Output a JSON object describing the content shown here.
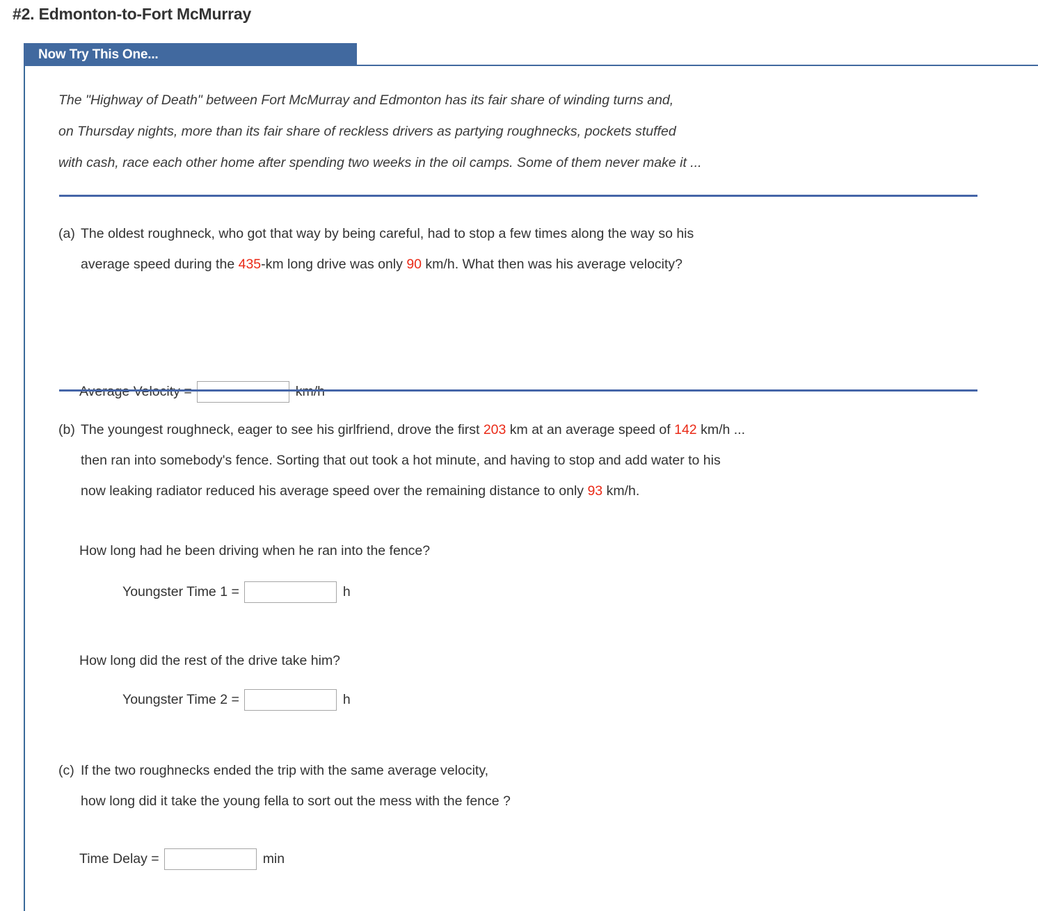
{
  "page": {
    "title": "#2. Edmonton-to-Fort McMurray",
    "tab_label": "Now Try This One...",
    "accent_blue": "#41699f",
    "separator_blue": "#4565a8",
    "value_red": "#ea2a17"
  },
  "intro": {
    "line1": "The \"Highway of Death\" between Fort McMurray and Edmonton has its fair share of winding turns and,",
    "line2": "on Thursday nights, more than its fair share of reckless drivers as partying roughnecks, pockets stuffed",
    "line3": "with cash, race each other home after spending two weeks in the oil camps. Some of them never make it ..."
  },
  "part_a": {
    "label": "(a)",
    "line1": "The oldest roughneck, who got that way by being careful, had to stop a few times along the way so his",
    "line2_pre": "average speed during the ",
    "distance": "435",
    "line2_mid": "-km long drive was only ",
    "speed": "90",
    "line2_post": " km/h. What then was his average velocity?",
    "answer_label": "Average Velocity =",
    "answer_value": "",
    "answer_placeholder": "",
    "answer_unit": "km/h"
  },
  "part_b": {
    "label": "(b)",
    "line1_pre": "The youngest roughneck, eager to see his girlfriend, drove the first ",
    "first_distance": "203",
    "line1_mid": " km at an average speed of ",
    "first_speed": "142",
    "line1_post": " km/h ...",
    "line2": "then ran into somebody's fence. Sorting that out took a hot minute, and having to stop and add water to his",
    "line3_pre": "now leaking radiator reduced his average speed over the remaining distance to only ",
    "second_speed": "93",
    "line3_post": " km/h.",
    "question1": "How long had he been driving when he ran into the fence?",
    "answer1_label": "Youngster Time 1 =",
    "answer1_value": "",
    "answer1_unit": "h",
    "question2": "How long did the rest of the drive take him?",
    "answer2_label": "Youngster Time 2 =",
    "answer2_value": "",
    "answer2_unit": "h"
  },
  "part_c": {
    "label": "(c)",
    "line1": "If the two roughnecks ended the trip with the same average velocity,",
    "line2": "how long did it take the young fella to sort out the mess with the fence ?",
    "answer_label": "Time Delay =",
    "answer_value": "",
    "answer_unit": "min"
  }
}
